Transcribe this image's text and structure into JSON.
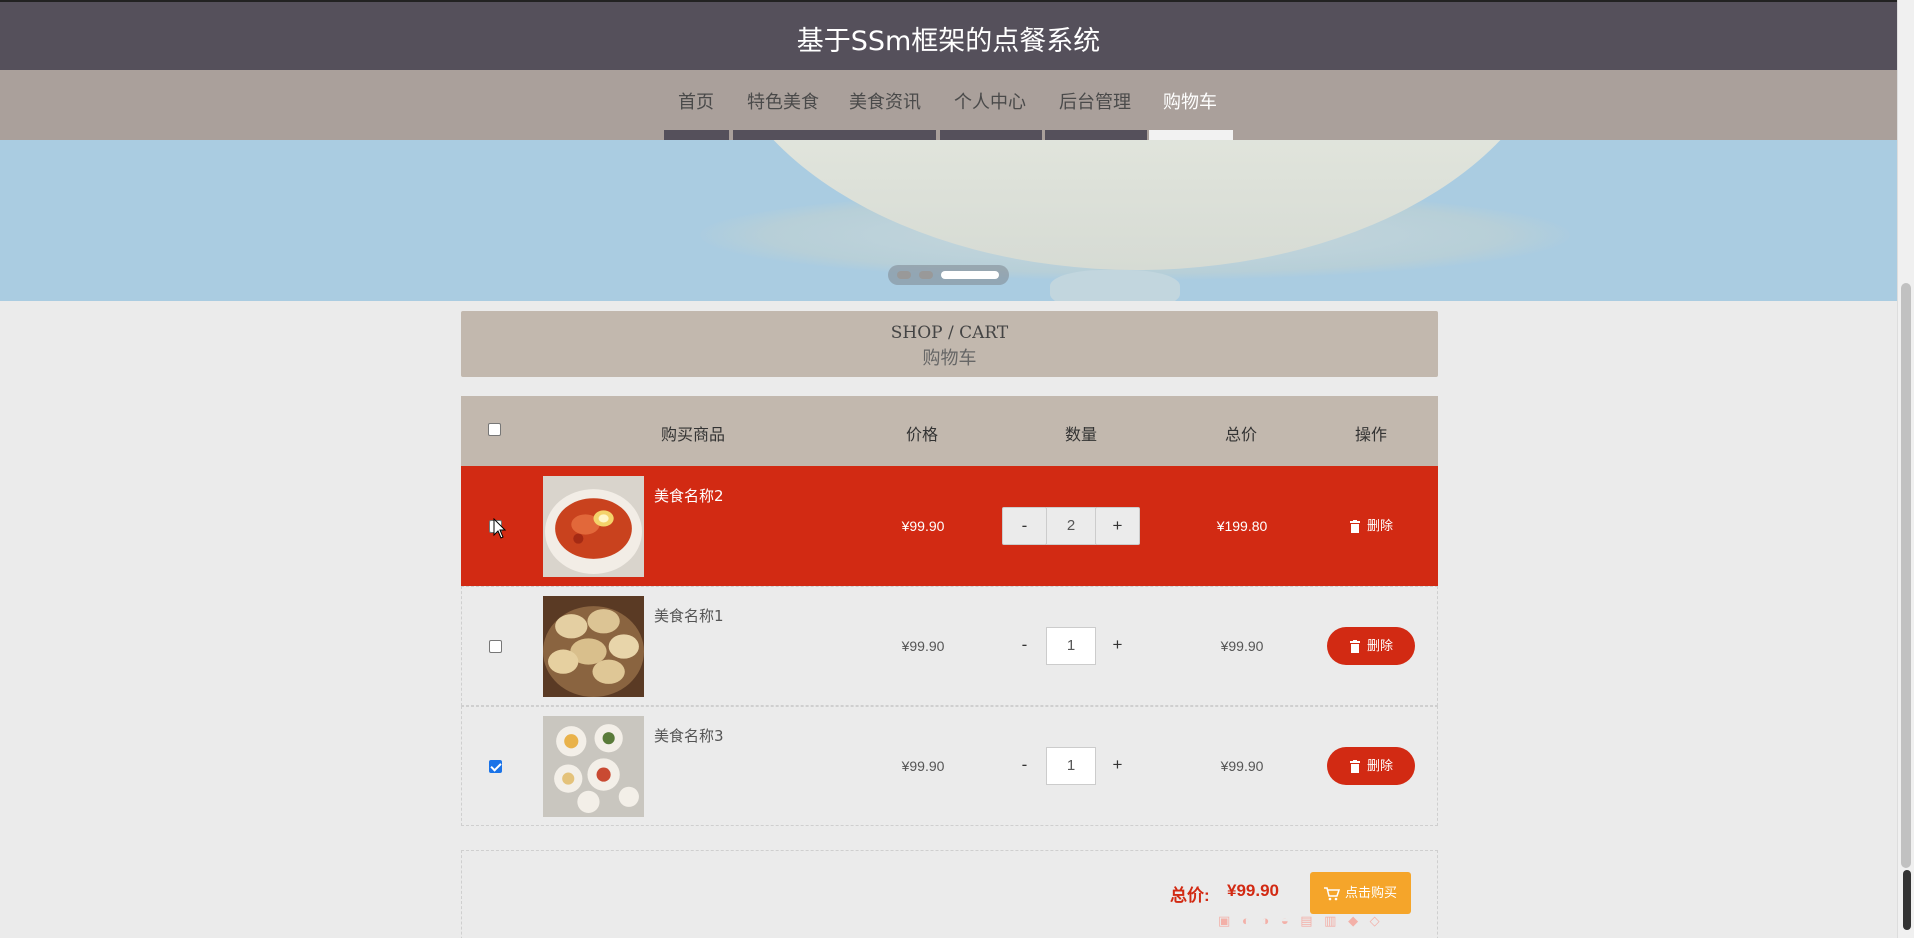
{
  "header": {
    "title": "基于SSm框架的点餐系统"
  },
  "nav": {
    "items": [
      {
        "label": "首页"
      },
      {
        "label": "特色美食"
      },
      {
        "label": "美食资讯"
      },
      {
        "label": "个人中心"
      },
      {
        "label": "后台管理"
      },
      {
        "label": "购物车",
        "active": true
      }
    ]
  },
  "banner": {
    "carousel_pages": 3,
    "active_page": 3
  },
  "cart_heading": {
    "en": "SHOP / CART",
    "cn": "购物车"
  },
  "table": {
    "columns": [
      "购买商品",
      "价格",
      "数量",
      "总价",
      "操作"
    ],
    "select_all_checked": false,
    "rows": [
      {
        "name": "美食名称2",
        "price": "¥99.90",
        "qty": "2",
        "total": "¥199.80",
        "checked": false,
        "highlighted": true,
        "delete_label": "删除",
        "minus": "-",
        "plus": "+"
      },
      {
        "name": "美食名称1",
        "price": "¥99.90",
        "qty": "1",
        "total": "¥99.90",
        "checked": false,
        "highlighted": false,
        "delete_label": "删除",
        "minus": "-",
        "plus": "+"
      },
      {
        "name": "美食名称3",
        "price": "¥99.90",
        "qty": "1",
        "total": "¥99.90",
        "checked": true,
        "highlighted": false,
        "delete_label": "删除",
        "minus": "-",
        "plus": "+"
      }
    ]
  },
  "summary": {
    "label": "总价:",
    "value": "¥99.90",
    "buy_label": "点击购买"
  },
  "colors": {
    "header": "#55505b",
    "nav": "#aaa09b",
    "accent": "#d22a13",
    "buy": "#f5a52a",
    "panel": "#c2b8ae"
  }
}
